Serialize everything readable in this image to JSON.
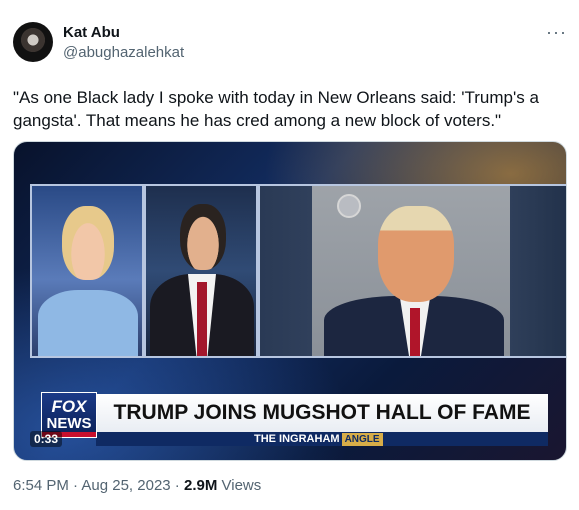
{
  "author": {
    "name": "Kat Abu",
    "handle": "@abughazalehkat"
  },
  "more_menu": "···",
  "tweet_text": "\"As one Black lady I spoke with today in New Orleans said: 'Trump's a gangsta'. That means he has cred among a new block of voters.\"",
  "video": {
    "headline": "TRUMP JOINS MUGSHOT HALL OF FAME",
    "show_name": "THE INGRAHAM",
    "show_name_accent": "ANGLE",
    "logo_top": "FOX",
    "logo_bottom": "NEWS",
    "timecode": "0:33"
  },
  "meta": {
    "time": "6:54 PM",
    "separator1": " · ",
    "date": "Aug 25, 2023",
    "separator2": " · ",
    "views_count": "2.9M",
    "views_label": " Views"
  }
}
